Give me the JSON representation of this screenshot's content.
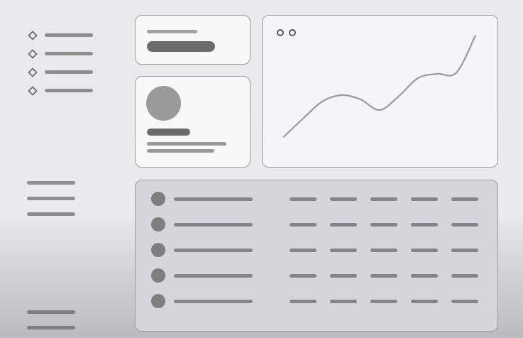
{
  "sidebar": {
    "nav_icons": [
      "diamond-icon",
      "diamond-icon",
      "diamond-icon",
      "diamond-icon"
    ],
    "nav_items": 4,
    "secondary_items": 3,
    "footer_items": 2
  },
  "main": {
    "summary_card": {},
    "profile_card": {
      "avatar_icon": "avatar-circle-icon"
    },
    "trend_chart": {
      "window_controls": [
        "circle-icon",
        "circle-icon"
      ]
    },
    "data_table": {
      "row_icon": "circle-icon"
    }
  },
  "chart_data": {
    "type": "line",
    "title": "",
    "xlabel": "",
    "ylabel": "",
    "x": [
      0,
      1,
      2,
      3,
      4,
      5,
      6,
      7,
      8,
      9,
      10
    ],
    "series": [
      {
        "values": [
          5,
          22,
          38,
          44,
          40,
          30,
          43,
          60,
          64,
          65,
          100
        ]
      }
    ],
    "ylim": [
      0,
      100
    ],
    "grid": false,
    "legend": "none"
  },
  "colors": {
    "page_bg": "#e9ebee",
    "card_bg": "#f8f8f9",
    "chart_bg": "#f4f5f7",
    "table_bg": "#d5d6db",
    "line": "#9a9a9a",
    "placeholder_dark": "#6b6b6b",
    "placeholder": "#8e8e8e",
    "placeholder_light": "#a2a2a2"
  }
}
